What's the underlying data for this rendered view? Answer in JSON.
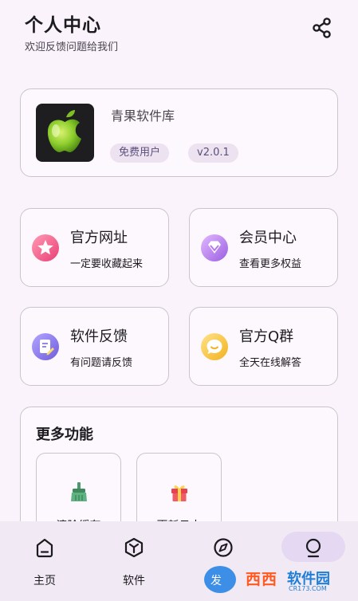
{
  "header": {
    "title": "个人中心",
    "subtitle": "欢迎反馈问题给我们",
    "share_icon": "share-icon"
  },
  "app": {
    "name": "青果软件库",
    "user_type": "免费用户",
    "version": "v2.0.1",
    "icon": "green-apple-logo"
  },
  "cards": [
    {
      "title": "官方网址",
      "subtitle": "一定要收藏起来",
      "icon": "star-badge-icon",
      "color": "#f0608a"
    },
    {
      "title": "会员中心",
      "subtitle": "查看更多权益",
      "icon": "diamond-icon",
      "color": "#b57ae8"
    },
    {
      "title": "软件反馈",
      "subtitle": "有问题请反馈",
      "icon": "document-edit-icon",
      "color": "#8b79e6"
    },
    {
      "title": "官方Q群",
      "subtitle": "全天在线解答",
      "icon": "chat-bubble-icon",
      "color": "#f7c33a"
    }
  ],
  "more": {
    "title": "更多功能",
    "tools": [
      {
        "label": "清除缓存",
        "icon": "broom-icon"
      },
      {
        "label": "更新日志",
        "icon": "gift-icon"
      }
    ]
  },
  "nav": {
    "items": [
      {
        "label": "主页",
        "icon": "home-icon",
        "active": false
      },
      {
        "label": "软件",
        "icon": "box-icon",
        "active": false
      },
      {
        "label": "",
        "icon": "compass-icon",
        "active": false
      },
      {
        "label": "",
        "icon": "person-icon",
        "active": true
      }
    ]
  },
  "watermark": {
    "brand": "西西软件园",
    "part1": "西西",
    "part2": "软件园",
    "domain": "CR173.COM",
    "badge": "发"
  }
}
